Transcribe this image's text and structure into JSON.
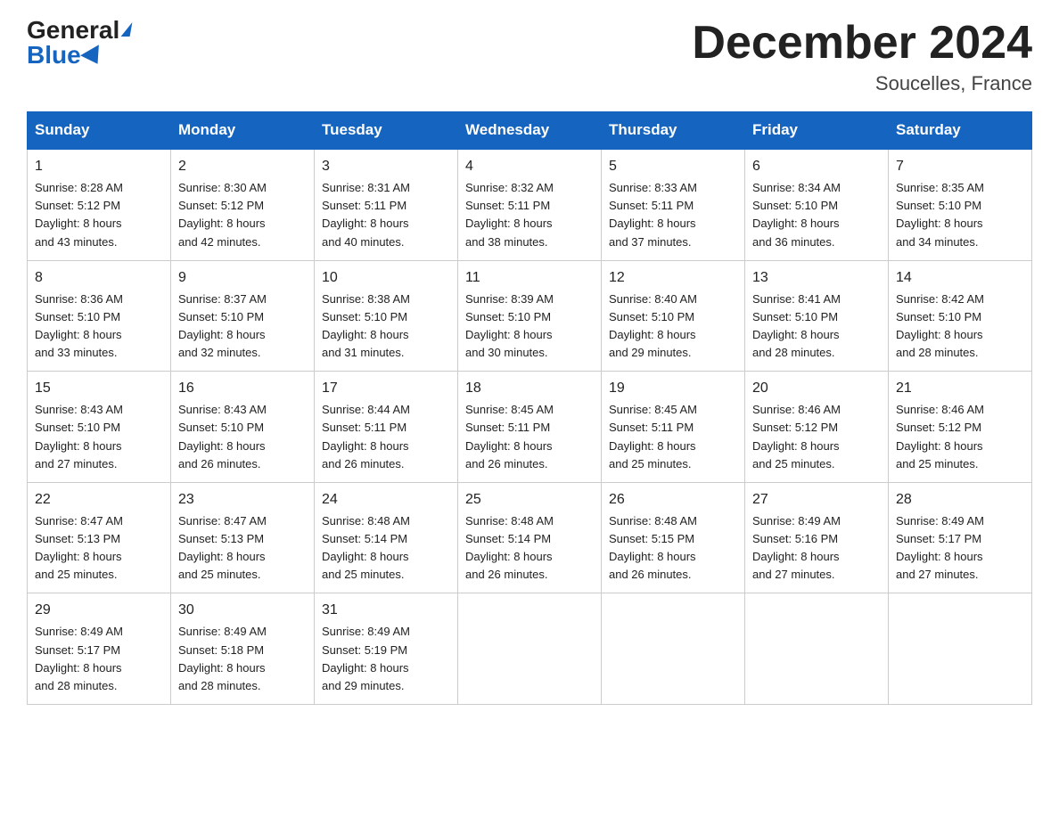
{
  "header": {
    "logo_general": "General",
    "logo_blue": "Blue",
    "month_title": "December 2024",
    "location": "Soucelles, France"
  },
  "days_of_week": [
    "Sunday",
    "Monday",
    "Tuesday",
    "Wednesday",
    "Thursday",
    "Friday",
    "Saturday"
  ],
  "weeks": [
    [
      {
        "day": "1",
        "sunrise": "8:28 AM",
        "sunset": "5:12 PM",
        "daylight": "8 hours and 43 minutes."
      },
      {
        "day": "2",
        "sunrise": "8:30 AM",
        "sunset": "5:12 PM",
        "daylight": "8 hours and 42 minutes."
      },
      {
        "day": "3",
        "sunrise": "8:31 AM",
        "sunset": "5:11 PM",
        "daylight": "8 hours and 40 minutes."
      },
      {
        "day": "4",
        "sunrise": "8:32 AM",
        "sunset": "5:11 PM",
        "daylight": "8 hours and 38 minutes."
      },
      {
        "day": "5",
        "sunrise": "8:33 AM",
        "sunset": "5:11 PM",
        "daylight": "8 hours and 37 minutes."
      },
      {
        "day": "6",
        "sunrise": "8:34 AM",
        "sunset": "5:10 PM",
        "daylight": "8 hours and 36 minutes."
      },
      {
        "day": "7",
        "sunrise": "8:35 AM",
        "sunset": "5:10 PM",
        "daylight": "8 hours and 34 minutes."
      }
    ],
    [
      {
        "day": "8",
        "sunrise": "8:36 AM",
        "sunset": "5:10 PM",
        "daylight": "8 hours and 33 minutes."
      },
      {
        "day": "9",
        "sunrise": "8:37 AM",
        "sunset": "5:10 PM",
        "daylight": "8 hours and 32 minutes."
      },
      {
        "day": "10",
        "sunrise": "8:38 AM",
        "sunset": "5:10 PM",
        "daylight": "8 hours and 31 minutes."
      },
      {
        "day": "11",
        "sunrise": "8:39 AM",
        "sunset": "5:10 PM",
        "daylight": "8 hours and 30 minutes."
      },
      {
        "day": "12",
        "sunrise": "8:40 AM",
        "sunset": "5:10 PM",
        "daylight": "8 hours and 29 minutes."
      },
      {
        "day": "13",
        "sunrise": "8:41 AM",
        "sunset": "5:10 PM",
        "daylight": "8 hours and 28 minutes."
      },
      {
        "day": "14",
        "sunrise": "8:42 AM",
        "sunset": "5:10 PM",
        "daylight": "8 hours and 28 minutes."
      }
    ],
    [
      {
        "day": "15",
        "sunrise": "8:43 AM",
        "sunset": "5:10 PM",
        "daylight": "8 hours and 27 minutes."
      },
      {
        "day": "16",
        "sunrise": "8:43 AM",
        "sunset": "5:10 PM",
        "daylight": "8 hours and 26 minutes."
      },
      {
        "day": "17",
        "sunrise": "8:44 AM",
        "sunset": "5:11 PM",
        "daylight": "8 hours and 26 minutes."
      },
      {
        "day": "18",
        "sunrise": "8:45 AM",
        "sunset": "5:11 PM",
        "daylight": "8 hours and 26 minutes."
      },
      {
        "day": "19",
        "sunrise": "8:45 AM",
        "sunset": "5:11 PM",
        "daylight": "8 hours and 25 minutes."
      },
      {
        "day": "20",
        "sunrise": "8:46 AM",
        "sunset": "5:12 PM",
        "daylight": "8 hours and 25 minutes."
      },
      {
        "day": "21",
        "sunrise": "8:46 AM",
        "sunset": "5:12 PM",
        "daylight": "8 hours and 25 minutes."
      }
    ],
    [
      {
        "day": "22",
        "sunrise": "8:47 AM",
        "sunset": "5:13 PM",
        "daylight": "8 hours and 25 minutes."
      },
      {
        "day": "23",
        "sunrise": "8:47 AM",
        "sunset": "5:13 PM",
        "daylight": "8 hours and 25 minutes."
      },
      {
        "day": "24",
        "sunrise": "8:48 AM",
        "sunset": "5:14 PM",
        "daylight": "8 hours and 25 minutes."
      },
      {
        "day": "25",
        "sunrise": "8:48 AM",
        "sunset": "5:14 PM",
        "daylight": "8 hours and 26 minutes."
      },
      {
        "day": "26",
        "sunrise": "8:48 AM",
        "sunset": "5:15 PM",
        "daylight": "8 hours and 26 minutes."
      },
      {
        "day": "27",
        "sunrise": "8:49 AM",
        "sunset": "5:16 PM",
        "daylight": "8 hours and 27 minutes."
      },
      {
        "day": "28",
        "sunrise": "8:49 AM",
        "sunset": "5:17 PM",
        "daylight": "8 hours and 27 minutes."
      }
    ],
    [
      {
        "day": "29",
        "sunrise": "8:49 AM",
        "sunset": "5:17 PM",
        "daylight": "8 hours and 28 minutes."
      },
      {
        "day": "30",
        "sunrise": "8:49 AM",
        "sunset": "5:18 PM",
        "daylight": "8 hours and 28 minutes."
      },
      {
        "day": "31",
        "sunrise": "8:49 AM",
        "sunset": "5:19 PM",
        "daylight": "8 hours and 29 minutes."
      },
      null,
      null,
      null,
      null
    ]
  ],
  "labels": {
    "sunrise": "Sunrise:",
    "sunset": "Sunset:",
    "daylight": "Daylight:"
  }
}
